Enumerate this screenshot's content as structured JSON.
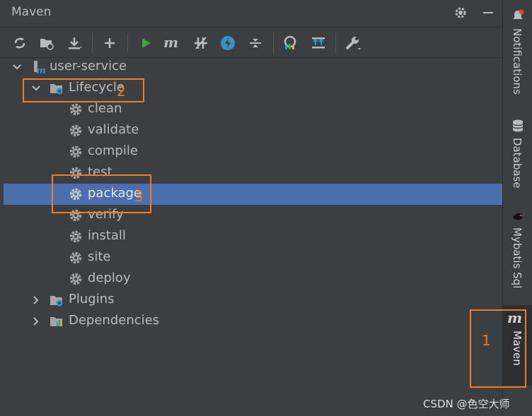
{
  "panel": {
    "title": "Maven"
  },
  "toolbar": {
    "buttons": [
      "reload-icon",
      "generate-sources-icon",
      "download-icon",
      "add-icon",
      "run-icon",
      "maven-goal-icon",
      "toggle-offline-icon",
      "skip-tests-icon",
      "collapse-icon",
      "show-dependencies-icon",
      "analyze-icon",
      "settings-wrench-icon"
    ]
  },
  "tree": {
    "project": "user-service",
    "lifecycle_label": "Lifecycle",
    "goals": [
      "clean",
      "validate",
      "compile",
      "test",
      "package",
      "verify",
      "install",
      "site",
      "deploy"
    ],
    "selected_goal": "package",
    "plugins_label": "Plugins",
    "dependencies_label": "Dependencies"
  },
  "stripe": {
    "tabs": [
      "Notifications",
      "Database",
      "Mybatis Sql",
      "Maven"
    ],
    "maven_badge": "m"
  },
  "annotations": [
    "1",
    "2",
    "3"
  ],
  "watermark": "CSDN @色空大师",
  "colors": {
    "accent": "#f07c22",
    "selection": "#4b6eaf",
    "background": "#3c3f41"
  }
}
